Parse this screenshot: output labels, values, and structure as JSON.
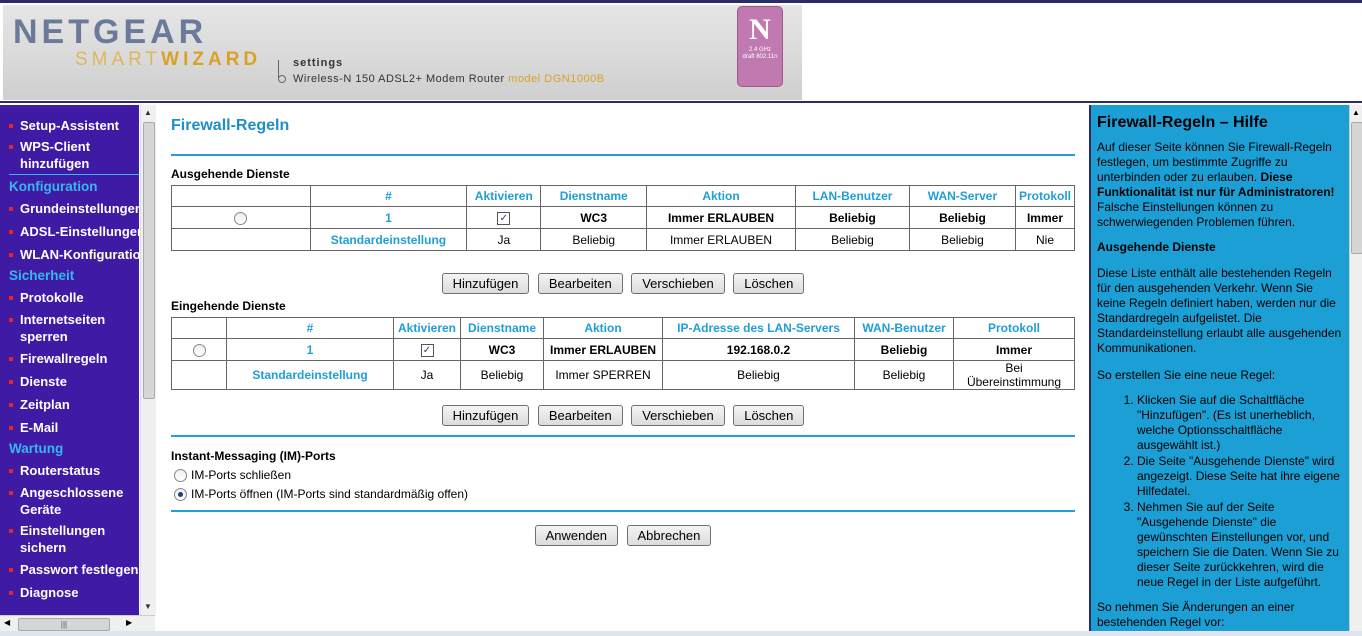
{
  "banner": {
    "brand": "NETGEAR",
    "product_plain": "SMART",
    "product_bold": "WIZARD",
    "settings": "settings",
    "model_text": "Wireless-N 150 ADSL2+ Modem Router",
    "model_code": "model DGN1000B",
    "badge_letter": "N",
    "badge_line1": "2.4 GHz",
    "badge_line2": "draft 802.11n"
  },
  "nav": {
    "items_top": [
      {
        "label": "Setup-Assistent"
      },
      {
        "label": "WPS-Client hinzufügen"
      }
    ],
    "section_konfiguration": "Konfiguration",
    "items_konfiguration": [
      {
        "label": "Grundeinstellungen"
      },
      {
        "label": "ADSL-Einstellungen"
      },
      {
        "label": "WLAN-Konfiguration"
      }
    ],
    "section_sicherheit": "Sicherheit",
    "items_sicherheit": [
      {
        "label": "Protokolle"
      },
      {
        "label": "Internetseiten sperren"
      },
      {
        "label": "Firewallregeln"
      },
      {
        "label": "Dienste"
      },
      {
        "label": "Zeitplan"
      },
      {
        "label": "E-Mail"
      }
    ],
    "section_wartung": "Wartung",
    "items_wartung": [
      {
        "label": "Routerstatus"
      },
      {
        "label": "Angeschlossene Geräte"
      },
      {
        "label": "Einstellungen sichern"
      },
      {
        "label": "Passwort festlegen"
      },
      {
        "label": "Diagnose"
      }
    ]
  },
  "main": {
    "title": "Firewall-Regeln",
    "outgoing": {
      "title": "Ausgehende Dienste",
      "headers": [
        "#",
        "Aktivieren",
        "Dienstname",
        "Aktion",
        "LAN-Benutzer",
        "WAN-Server",
        "Protokoll"
      ],
      "row1": {
        "num": "1",
        "service": "WC3",
        "action": "Immer ERLAUBEN",
        "lan": "Beliebig",
        "wan": "Beliebig",
        "proto": "Immer"
      },
      "default": {
        "label": "Standardeinstellung",
        "enabled": "Ja",
        "service": "Beliebig",
        "action": "Immer ERLAUBEN",
        "lan": "Beliebig",
        "wan": "Beliebig",
        "proto": "Nie"
      }
    },
    "incoming": {
      "title": "Eingehende Dienste",
      "headers": [
        "#",
        "Aktivieren",
        "Dienstname",
        "Aktion",
        "IP-Adresse des LAN-Servers",
        "WAN-Benutzer",
        "Protokoll"
      ],
      "row1": {
        "num": "1",
        "service": "WC3",
        "action": "Immer ERLAUBEN",
        "ip": "192.168.0.2",
        "wan": "Beliebig",
        "proto": "Immer"
      },
      "default": {
        "label": "Standardeinstellung",
        "enabled": "Ja",
        "service": "Beliebig",
        "action": "Immer SPERREN",
        "ip": "Beliebig",
        "wan": "Beliebig",
        "proto": "Bei Übereinstimmung"
      }
    },
    "buttons": {
      "add": "Hinzufügen",
      "edit": "Bearbeiten",
      "move": "Verschieben",
      "delete": "Löschen"
    },
    "im": {
      "title": "Instant-Messaging (IM)-Ports",
      "option_close": "IM-Ports schließen",
      "option_open": "IM-Ports öffnen (IM-Ports sind standardmäßig offen)",
      "selected": "open"
    },
    "apply": "Anwenden",
    "cancel": "Abbrechen"
  },
  "help": {
    "title": "Firewall-Regeln – Hilfe",
    "intro": "Auf dieser Seite können Sie Firewall-Regeln festlegen, um bestimmte Zugriffe zu unterbinden oder zu erlauben.",
    "intro_bold": "Diese Funktionalität ist nur für Administratoren!",
    "intro_tail": "Falsche Einstellungen können zu schwerwiegenden Problemen führen.",
    "section1": "Ausgehende Dienste",
    "para1": "Diese Liste enthält alle bestehenden Regeln für den ausgehenden Verkehr. Wenn Sie keine Regeln definiert haben, werden nur die Standardregeln aufgelistet. Die Standardeinstellung erlaubt alle ausgehenden Kommunikationen.",
    "para2": "So erstellen Sie eine neue Regel:",
    "steps": [
      "Klicken Sie auf die Schaltfläche \"Hinzufügen\". (Es ist unerheblich, welche Optionsschaltfläche ausgewählt ist.)",
      "Die Seite \"Ausgehende Dienste\" wird angezeigt. Diese Seite hat ihre eigene Hilfedatei.",
      "Nehmen Sie auf der Seite \"Ausgehende Dienste\" die gewünschten Einstellungen vor, und speichern Sie die Daten. Wenn Sie zu dieser Seite zurückkehren, wird die neue Regel in der Liste aufgeführt."
    ],
    "para3": "So nehmen Sie Änderungen an einer bestehenden Regel vor:"
  },
  "colors": {
    "nav_bg": "#3f1aa4",
    "accent": "#1f9ed8",
    "help_bg": "#1b9fd5",
    "bullet": "#e22222"
  }
}
